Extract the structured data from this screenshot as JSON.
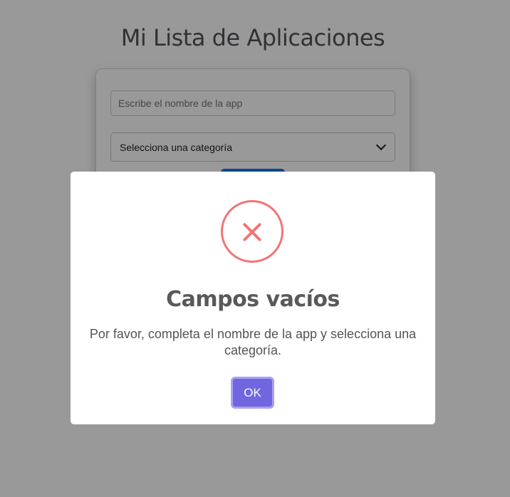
{
  "page": {
    "title": "Mi Lista de Aplicaciones",
    "app_input": {
      "placeholder": "Escribe el nombre de la app",
      "value": ""
    },
    "category_select": {
      "selected": "Selecciona una categoría"
    }
  },
  "modal": {
    "icon": "error-x-icon",
    "title": "Campos vacíos",
    "text": "Por favor, completa el nombre de la app y selecciona una categoría.",
    "confirm_label": "OK"
  },
  "colors": {
    "error": "#f27474",
    "confirm_button": "#7066e0",
    "add_button": "#1a73e8",
    "overlay": "rgba(0,0,0,0.4)"
  }
}
